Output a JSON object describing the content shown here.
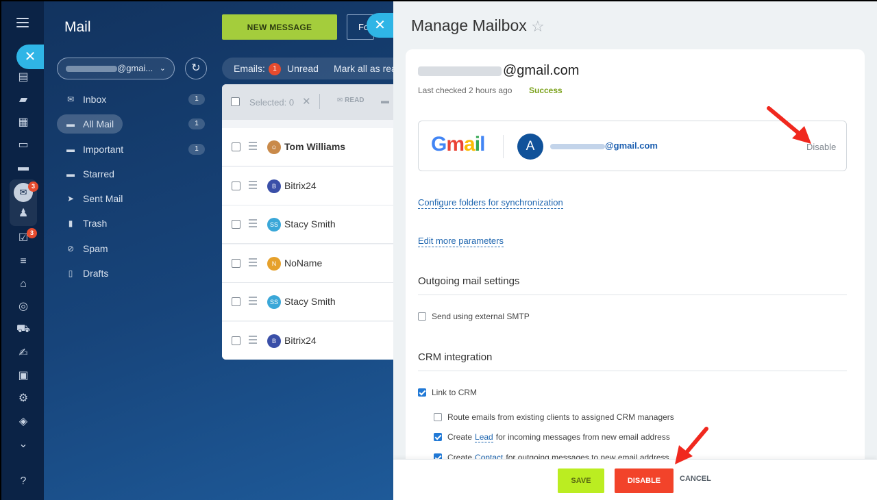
{
  "rail": {
    "mail_badge": "3",
    "tasks_badge": "3",
    "close_glyph": "✕",
    "icons": [
      "feed-icon",
      "chat-icon",
      "calendar-icon",
      "docs-icon",
      "drive-icon",
      "mail-icon",
      "groups-icon",
      "tasks-icon",
      "funnel-icon",
      "bank-icon",
      "target-icon",
      "cart-icon",
      "sign-icon",
      "contact-card-icon",
      "robot-icon",
      "box-icon",
      "more-icon",
      "help-icon"
    ]
  },
  "mail": {
    "title": "Mail",
    "new_message": "NEW MESSAGE",
    "fo_label": "Fo",
    "account_suffix": "@gmai...",
    "folders": [
      {
        "label": "Inbox",
        "count": "1",
        "icon": "inbox-icon"
      },
      {
        "label": "All Mail",
        "count": "1",
        "icon": "folder-icon"
      },
      {
        "label": "Important",
        "count": "1",
        "icon": "folder-icon"
      },
      {
        "label": "Starred",
        "count": "",
        "icon": "folder-icon"
      },
      {
        "label": "Sent Mail",
        "count": "",
        "icon": "sent-icon"
      },
      {
        "label": "Trash",
        "count": "",
        "icon": "trash-icon"
      },
      {
        "label": "Spam",
        "count": "",
        "icon": "spam-icon"
      },
      {
        "label": "Drafts",
        "count": "",
        "icon": "drafts-icon"
      }
    ],
    "filter": {
      "emails_label": "Emails:",
      "unread_count": "1",
      "unread_label": "Unread",
      "mark_all": "Mark all as rea"
    },
    "list_header": {
      "selected": "Selected: 0",
      "read": "READ"
    },
    "rows": [
      {
        "name": "Tom Williams",
        "initials": "",
        "color": "#c98a4a"
      },
      {
        "name": "Bitrix24",
        "initials": "B",
        "color": "#3a4fa8"
      },
      {
        "name": "Stacy Smith",
        "initials": "SS",
        "color": "#3aa7d8"
      },
      {
        "name": "NoName",
        "initials": "N",
        "color": "#e6a12c"
      },
      {
        "name": "Stacy Smith",
        "initials": "SS",
        "color": "#3aa7d8"
      },
      {
        "name": "Bitrix24",
        "initials": "B",
        "color": "#3a4fa8"
      }
    ]
  },
  "panel": {
    "title": "Manage Mailbox",
    "email_suffix": "@gmail.com",
    "last_checked": "Last checked 2 hours ago",
    "status": "Success",
    "account_initial": "A",
    "account_email_suffix": "@gmail.com",
    "disable_link": "Disable",
    "configure_folders": "Configure folders for synchronization",
    "edit_params": "Edit more parameters",
    "outgoing_title": "Outgoing mail settings",
    "smtp_label": "Send using external SMTP",
    "crm_title": "CRM integration",
    "link_crm": "Link to CRM",
    "route_emails": "Route emails from existing clients to assigned CRM managers",
    "create_lead_pre": "Create",
    "create_lead_kw": "Lead",
    "create_lead_post": "for incoming messages from new email address",
    "create_contact_pre": "Create",
    "create_contact_kw": "Contact",
    "create_contact_post": "for outgoing messages to new email address",
    "save": "SAVE",
    "disable": "DISABLE",
    "cancel": "CANCEL"
  },
  "colors": {
    "accent_blue": "#2fb5e6",
    "success_green": "#7aa11a",
    "save_green": "#bbed21",
    "danger_red": "#f2432a",
    "arrow_red": "#f0281e"
  }
}
